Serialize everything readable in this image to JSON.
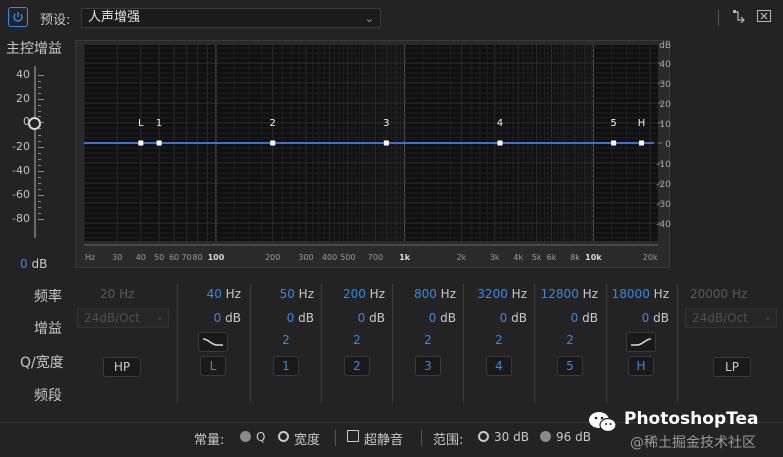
{
  "header": {
    "preset_label": "预设:",
    "preset_value": "人声增强",
    "power_icon": "power-icon",
    "icon_right_1": "routing-icon",
    "icon_right_2": "close-box-icon"
  },
  "master": {
    "title": "主控增益",
    "scale": [
      "40",
      "20",
      "0",
      "-20",
      "-40",
      "-60",
      "-80"
    ],
    "value": "0",
    "unit": "dB"
  },
  "graph": {
    "db_labels": [
      "dB",
      "40",
      "30",
      "20",
      "10",
      "0",
      "-10",
      "-20",
      "-30",
      "-40"
    ],
    "freq_labels": [
      "Hz",
      "30",
      "40",
      "50",
      "60",
      "70",
      "80",
      "100",
      "200",
      "300",
      "400",
      "500",
      "700",
      "1k",
      "2k",
      "3k",
      "4k",
      "5k",
      "6k",
      "8k",
      "10k",
      "20k"
    ],
    "points": [
      "L",
      "1",
      "2",
      "3",
      "4",
      "5",
      "H"
    ]
  },
  "row_labels": {
    "freq": "频率",
    "gain": "增益",
    "q": "Q/宽度",
    "band": "频段"
  },
  "hp": {
    "freq": "20 Hz",
    "slope": "24dB/Oct",
    "label": "HP"
  },
  "lp": {
    "freq": "20000 Hz",
    "slope": "24dB/Oct",
    "label": "LP"
  },
  "bands": [
    {
      "freq": "40",
      "gain": "0",
      "q": "",
      "label": "L",
      "shape": "low-shelf-icon"
    },
    {
      "freq": "50",
      "gain": "0",
      "q": "2",
      "label": "1"
    },
    {
      "freq": "200",
      "gain": "0",
      "q": "2",
      "label": "2"
    },
    {
      "freq": "800",
      "gain": "0",
      "q": "2",
      "label": "3"
    },
    {
      "freq": "3200",
      "gain": "0",
      "q": "2",
      "label": "4"
    },
    {
      "freq": "12800",
      "gain": "0",
      "q": "2",
      "label": "5"
    },
    {
      "freq": "18000",
      "gain": "0",
      "q": "",
      "label": "H",
      "shape": "high-shelf-icon"
    }
  ],
  "units": {
    "hz": "Hz",
    "db": "dB"
  },
  "footer": {
    "constant_label": "常量:",
    "q_label": "Q",
    "width_label": "宽度",
    "ultra_quiet_label": "超静音",
    "range_label": "范围:",
    "range_30": "30 dB",
    "range_96": "96 dB"
  },
  "watermark": {
    "name": "PhotoshopTea",
    "sub": "@稀土掘金技术社区"
  },
  "colors": {
    "accent": "#2d8ceb",
    "curve": "#3a6fd8"
  }
}
